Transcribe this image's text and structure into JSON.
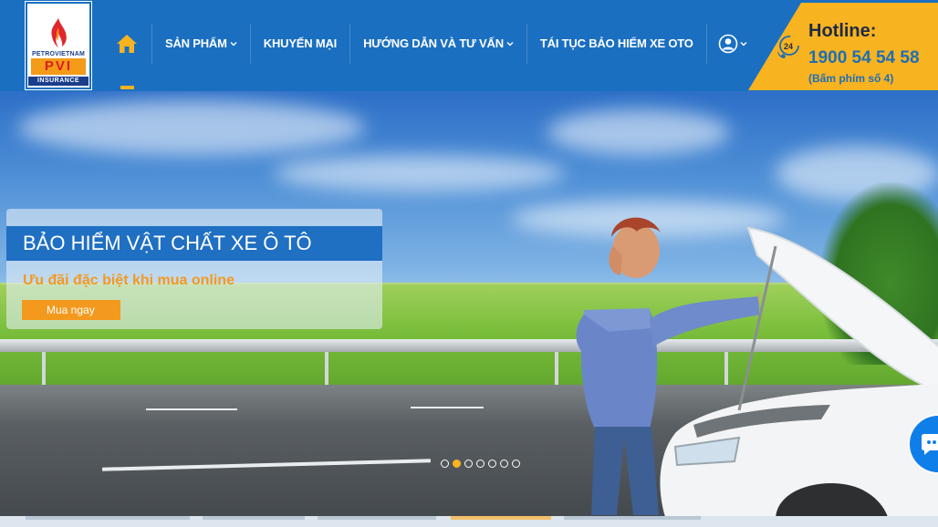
{
  "logo": {
    "top_text": "PETROVIETNAM",
    "mid_text": "PVI",
    "bottom_text": "INSURANCE"
  },
  "nav": {
    "home_icon": "home-icon",
    "items": [
      {
        "label": "SẢN PHẨM",
        "has_dropdown": true
      },
      {
        "label": "KHUYẾN MẠI",
        "has_dropdown": false
      },
      {
        "label": "HƯỚNG DẪN VÀ TƯ VẤN",
        "has_dropdown": true
      },
      {
        "label": "TÁI TỤC BẢO HIỂM XE OTO",
        "has_dropdown": false
      }
    ],
    "user_icon": "user-icon"
  },
  "hotline": {
    "label": "Hotline:",
    "number": "1900 54 54 58",
    "note": "(Bấm phím số 4)",
    "icon": "24h-phone-icon"
  },
  "hero": {
    "title": "BẢO HIỂM VẬT CHẤT XE Ô TÔ",
    "subtitle": "Ưu đãi đặc biệt khi mua online",
    "button_label": "Mua ngay",
    "slide_count": 7,
    "active_slide": 2
  },
  "colors": {
    "header_bg": "#1a6fc1",
    "accent_yellow": "#f8b320",
    "accent_orange": "#f39a1e",
    "title_bar": "#1f6fc3"
  },
  "chat_icon": "chat-bubble-icon"
}
